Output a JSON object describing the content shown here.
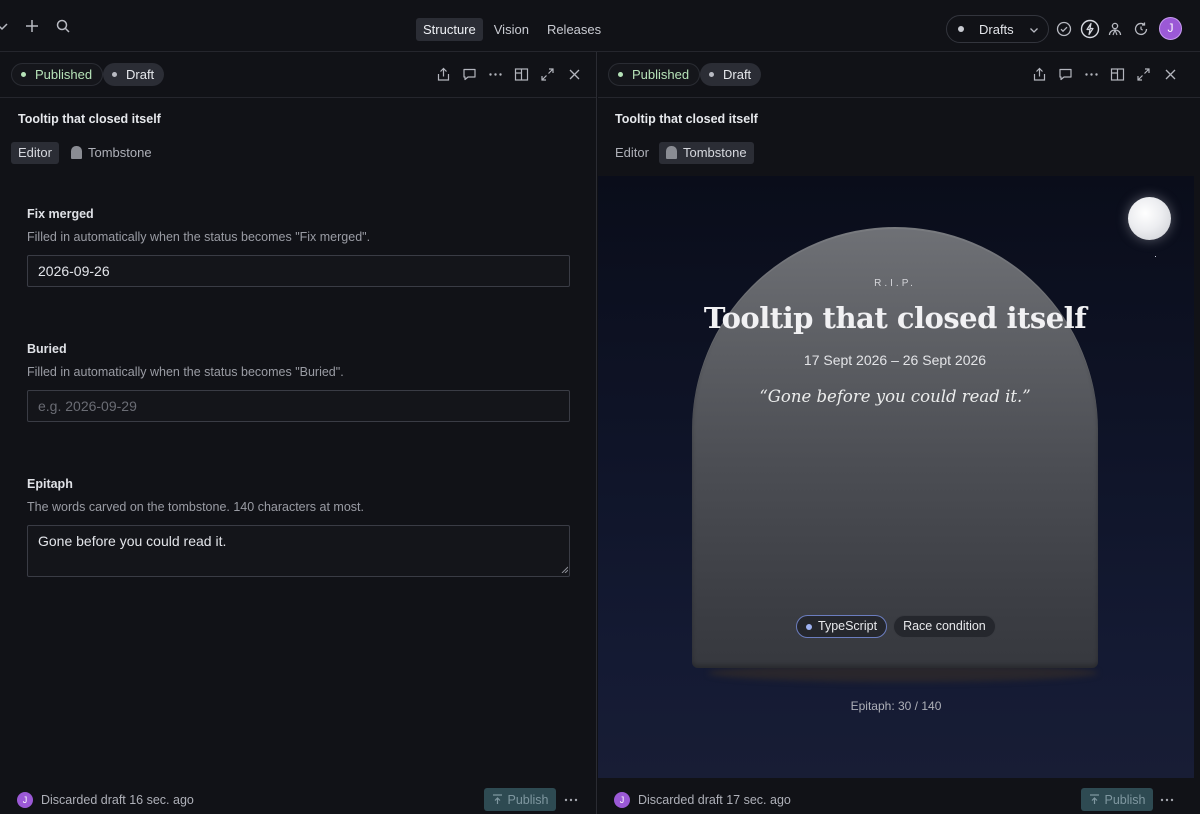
{
  "topbar": {
    "nav_tabs": [
      {
        "label": "Structure",
        "active": true
      },
      {
        "label": "Vision",
        "active": false
      },
      {
        "label": "Releases",
        "active": false
      }
    ],
    "drafts_label": "Drafts",
    "avatar_initial": "J"
  },
  "left_pane": {
    "status_published": "Published",
    "status_draft": "Draft",
    "doc_title": "Tooltip that closed itself",
    "view_tabs": {
      "editor": "Editor",
      "tombstone": "Tombstone",
      "active": "editor"
    },
    "fields": {
      "fix_merged": {
        "label": "Fix merged",
        "description": "Filled in automatically when the status becomes \"Fix merged\".",
        "value": "2026-09-26"
      },
      "buried": {
        "label": "Buried",
        "description": "Filled in automatically when the status becomes \"Buried\".",
        "value": "",
        "placeholder": "e.g. 2026-09-29"
      },
      "epitaph": {
        "label": "Epitaph",
        "description": "The words carved on the tombstone. 140 characters at most.",
        "value": "Gone before you could read it."
      }
    },
    "footer": {
      "avatar_initial": "J",
      "status": "Discarded draft 16 sec. ago",
      "publish_label": "Publish"
    }
  },
  "right_pane": {
    "status_published": "Published",
    "status_draft": "Draft",
    "doc_title": "Tooltip that closed itself",
    "view_tabs": {
      "editor": "Editor",
      "tombstone": "Tombstone",
      "active": "tombstone"
    },
    "tombstone": {
      "rip": "R.I.P.",
      "title": "Tooltip that closed itself",
      "dates": "17 Sept 2026 – 26 Sept 2026",
      "epitaph": "“Gone before you could read it.”",
      "tags": [
        "TypeScript",
        "Race condition"
      ]
    },
    "counter": "Epitaph: 30 / 140",
    "footer": {
      "avatar_initial": "J",
      "status": "Discarded draft 17 sec. ago",
      "publish_label": "Publish"
    }
  },
  "colors": {
    "background": "#111217",
    "published_green": "#b6e3b8",
    "accent_purple": "#9b59d6",
    "publish_button": "#2e4a52",
    "tag_dot": "#9fb2f2"
  }
}
